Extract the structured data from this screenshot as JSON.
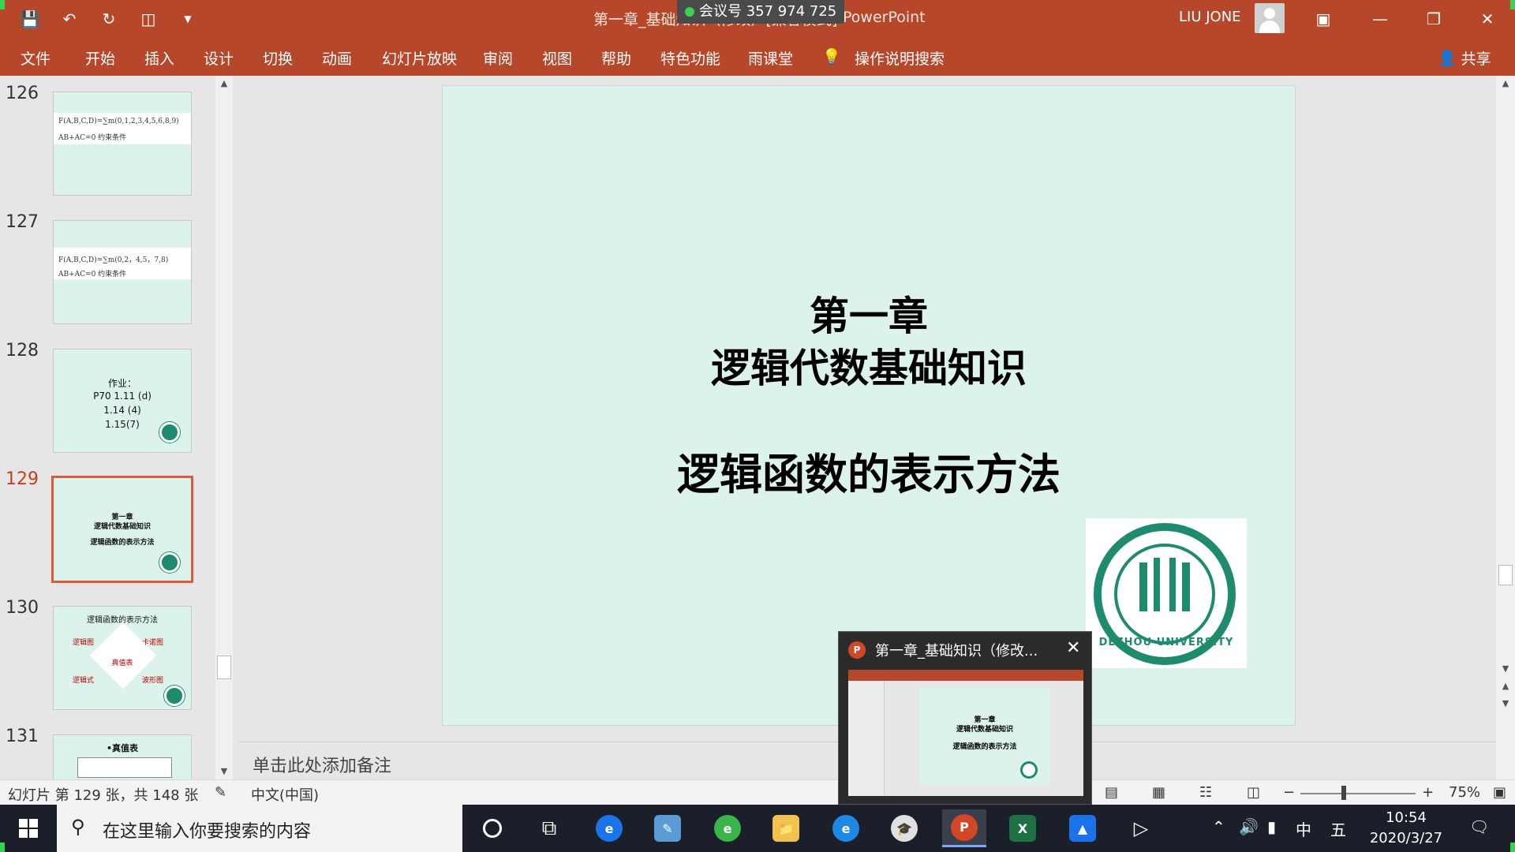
{
  "titlebar": {
    "doc_title": "第一章_基础知识（修改）[兼容模式]",
    "app_name": "PowerPoint",
    "meeting_id": "会议号 357 974 725",
    "user_name": "LIU JONE",
    "accent_color": "#b7472a"
  },
  "ribbon": {
    "tabs": [
      "文件",
      "开始",
      "插入",
      "设计",
      "切换",
      "动画",
      "幻灯片放映",
      "审阅",
      "视图",
      "帮助",
      "特色功能",
      "雨课堂",
      "操作说明搜索"
    ],
    "share_label": "共享"
  },
  "thumbnails": [
    {
      "num": "126",
      "lines": [
        "F(A,B,C,D)=∑m(0,1,2,3,4,5,6,8,9)",
        "AB+AC=0   约束条件"
      ]
    },
    {
      "num": "127",
      "lines": [
        "F(A,B,C,D)=∑m(0,2，4,5，7,8)",
        "AB+AC=0   约束条件"
      ]
    },
    {
      "num": "128",
      "lines": [
        "作业：",
        "P70    1.11 (d)",
        "1.14 (4)",
        "1.15(7)"
      ]
    },
    {
      "num": "129",
      "lines": [
        "第一章",
        "逻辑代数基础知识",
        "逻辑函数的表示方法"
      ]
    },
    {
      "num": "130",
      "lines": [
        "逻辑函数的表示方法",
        "逻辑图",
        "卡诺图",
        "真值表",
        "逻辑式",
        "波形图"
      ]
    },
    {
      "num": "131",
      "lines": [
        "•真值表"
      ]
    }
  ],
  "slide": {
    "line1": "第一章",
    "line2": "逻辑代数基础知识",
    "line3": "逻辑函数的表示方法",
    "emblem_text": "DEZHOU UNIVERSITY"
  },
  "notes_placeholder": "单击此处添加备注",
  "statusbar": {
    "slide_info": "幻灯片 第 129 张，共 148 张",
    "language": "中文(中国)",
    "zoom": "75%",
    "zoom_value": 0.75
  },
  "preview": {
    "title": "第一章_基础知识（修改..."
  },
  "taskbar": {
    "search_placeholder": "在这里输入你要搜索的内容",
    "ime_lang": "中",
    "ime_mode": "五",
    "time": "10:54",
    "date": "2020/3/27"
  }
}
